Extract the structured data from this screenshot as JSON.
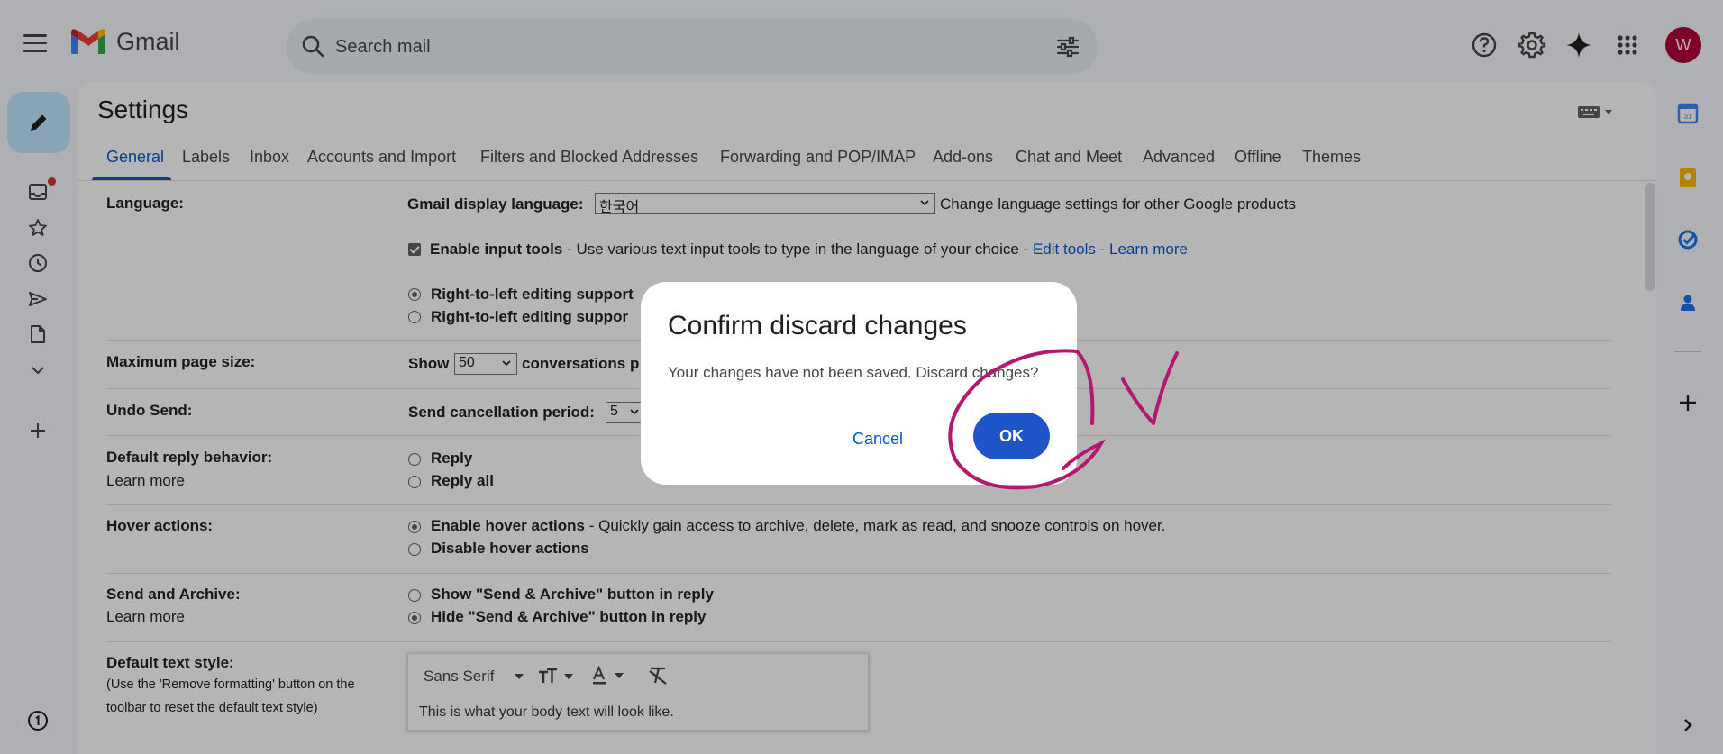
{
  "app": {
    "name": "Gmail"
  },
  "search": {
    "placeholder": "Search mail"
  },
  "user": {
    "avatar_initial": "W"
  },
  "settings": {
    "title": "Settings",
    "tabs": [
      "General",
      "Labels",
      "Inbox",
      "Accounts and Import",
      "Filters and Blocked Addresses",
      "Forwarding and POP/IMAP",
      "Add-ons",
      "Chat and Meet",
      "Advanced",
      "Offline",
      "Themes"
    ],
    "active_tab": "General"
  },
  "general": {
    "language": {
      "label": "Language:",
      "display_language_label": "Gmail display language:",
      "display_language_value": "한국어",
      "change_link": "Change language settings for other Google products",
      "enable_input_tools": "Enable input tools",
      "input_tools_desc": " - Use various text input tools to type in the language of your choice - ",
      "edit_tools": "Edit tools",
      "dash": " - ",
      "learn_more": "Learn more",
      "rtl_on": "Right-to-left editing support",
      "rtl_off": "Right-to-left editing suppor"
    },
    "page_size": {
      "label": "Maximum page size:",
      "show": "Show",
      "value": "50",
      "suffix": "conversations p"
    },
    "undo_send": {
      "label": "Undo Send:",
      "period_label": "Send cancellation period:",
      "value": "5"
    },
    "reply": {
      "label": "Default reply behavior:",
      "learn_more": "Learn more",
      "option_reply": "Reply",
      "option_reply_all": "Reply all"
    },
    "hover": {
      "label": "Hover actions:",
      "enable": "Enable hover actions",
      "enable_desc": " - Quickly gain access to archive, delete, mark as read, and snooze controls on hover.",
      "disable": "Disable hover actions"
    },
    "send_archive": {
      "label": "Send and Archive:",
      "learn_more": "Learn more",
      "show": "Show \"Send & Archive\" button in reply",
      "hide": "Hide \"Send & Archive\" button in reply"
    },
    "text_style": {
      "label": "Default text style:",
      "hint_line1": "(Use the 'Remove formatting' button on the",
      "hint_line2": "toolbar to reset the default text style)",
      "font": "Sans Serif",
      "preview": "This is what your body text will look like."
    }
  },
  "dialog": {
    "title": "Confirm discard changes",
    "body": "Your changes have not been saved. Discard changes?",
    "cancel": "Cancel",
    "ok": "OK"
  },
  "colors": {
    "accent": "#0b57d0",
    "ok_button": "#1f55c8",
    "annotation": "#b5176f"
  }
}
